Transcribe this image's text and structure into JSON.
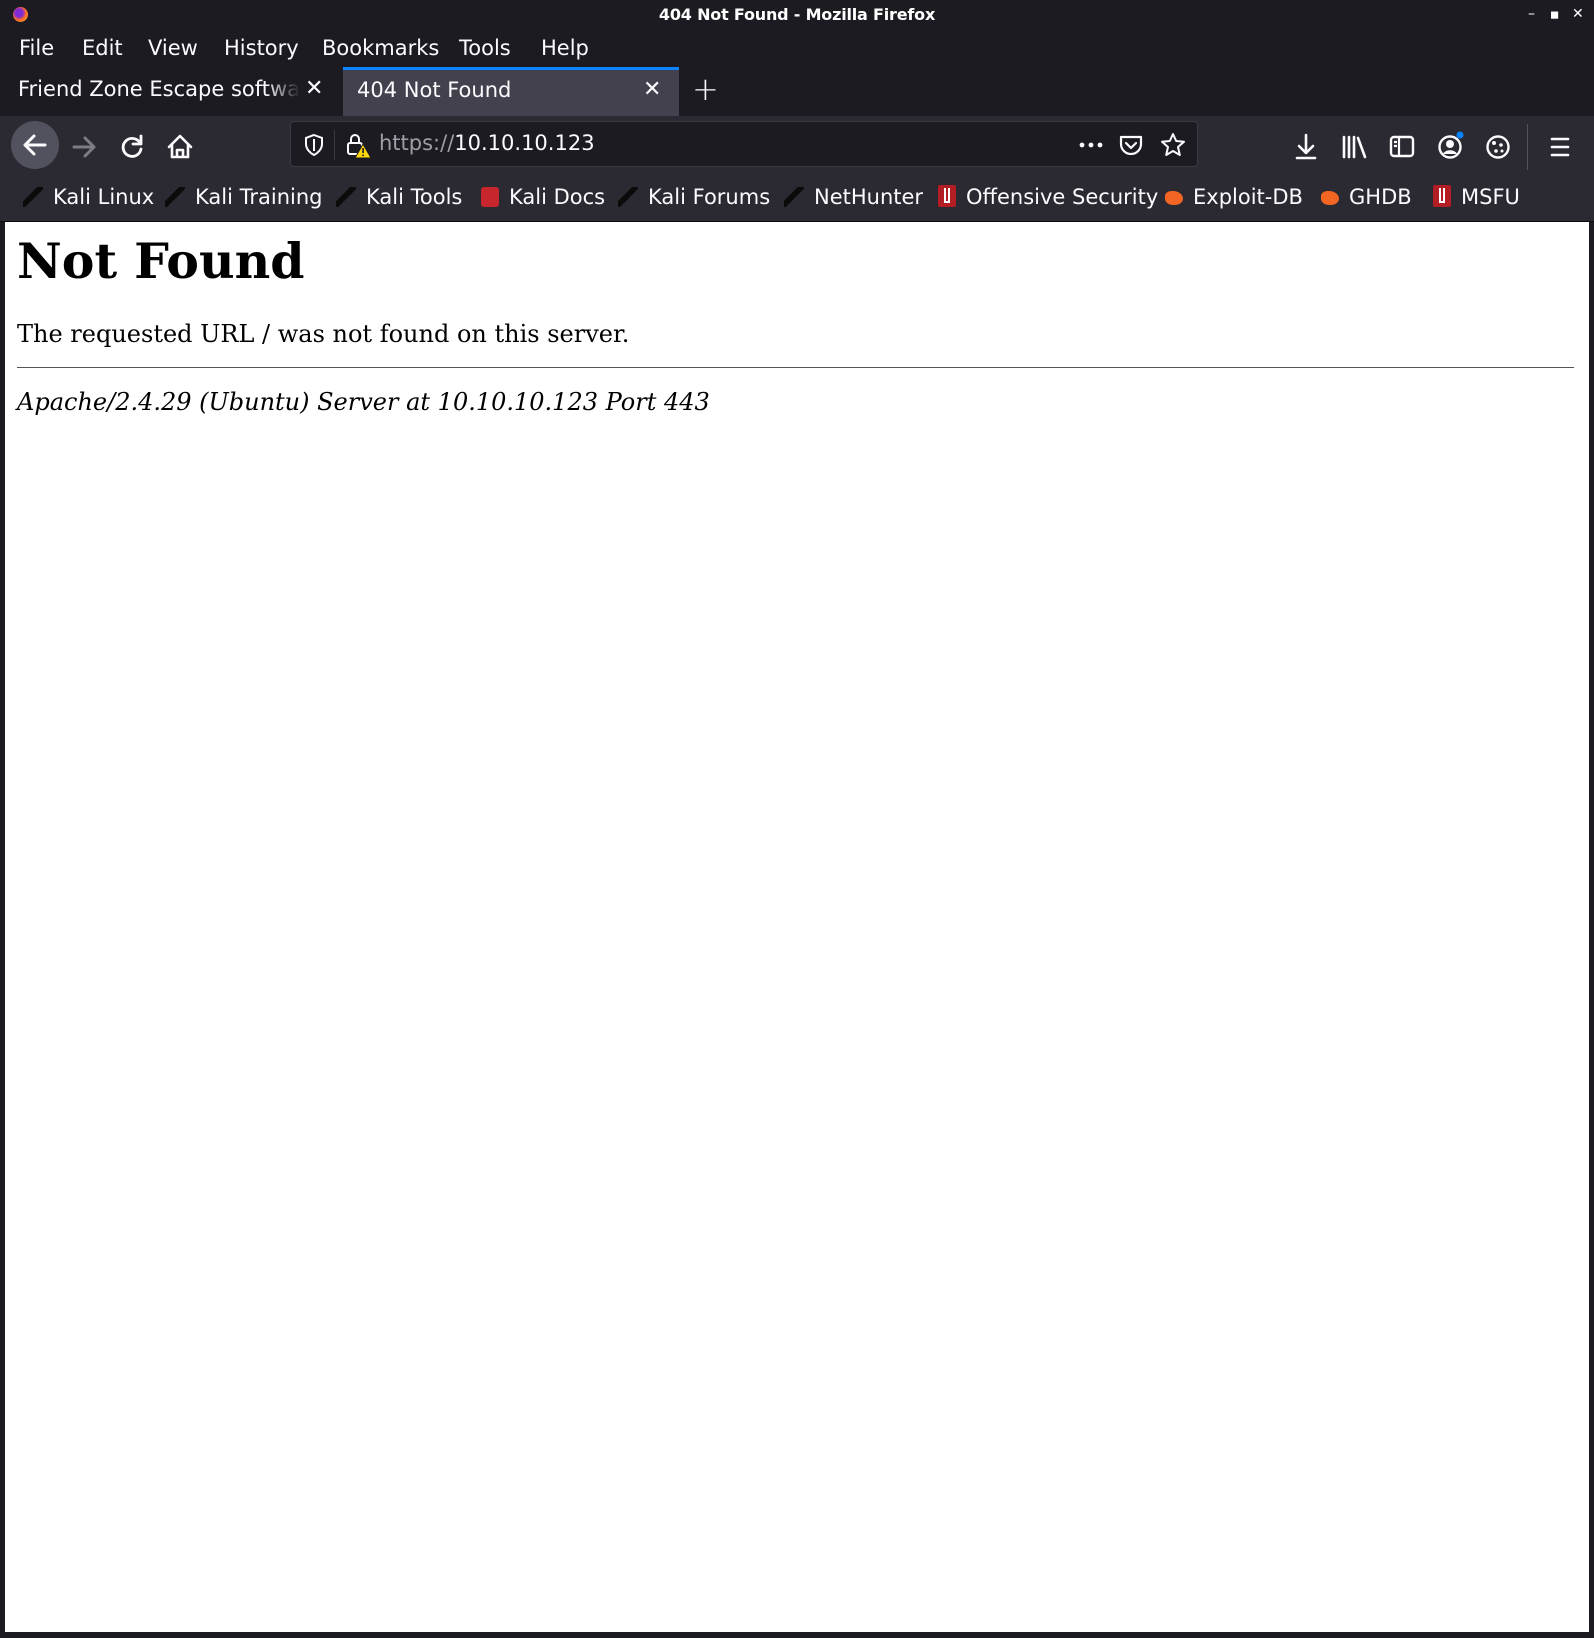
{
  "window": {
    "title": "404 Not Found - Mozilla Firefox"
  },
  "menubar": {
    "items": [
      "File",
      "Edit",
      "View",
      "History",
      "Bookmarks",
      "Tools",
      "Help"
    ]
  },
  "tabs": [
    {
      "label": "Friend Zone Escape software",
      "active": false
    },
    {
      "label": "404 Not Found",
      "active": true
    }
  ],
  "urlbar": {
    "protocol": "https://",
    "host": "10.10.10.123"
  },
  "bookmarks": [
    {
      "label": "Kali Linux",
      "icon": "kali-dragon-icon"
    },
    {
      "label": "Kali Training",
      "icon": "kali-dragon-icon"
    },
    {
      "label": "Kali Tools",
      "icon": "kali-dragon-icon"
    },
    {
      "label": "Kali Docs",
      "icon": "kali-docs-icon"
    },
    {
      "label": "Kali Forums",
      "icon": "kali-dragon-icon"
    },
    {
      "label": "NetHunter",
      "icon": "kali-dragon-icon"
    },
    {
      "label": "Offensive Security",
      "icon": "offsec-icon"
    },
    {
      "label": "Exploit-DB",
      "icon": "exploit-db-icon"
    },
    {
      "label": "GHDB",
      "icon": "exploit-db-icon"
    },
    {
      "label": "MSFU",
      "icon": "offsec-icon"
    }
  ],
  "page": {
    "heading": "Not Found",
    "message": "The requested URL / was not found on this server.",
    "signature": "Apache/2.4.29 (Ubuntu) Server at 10.10.10.123 Port 443"
  },
  "colors": {
    "chrome_dark": "#1c1b22",
    "toolbar": "#2b2a33",
    "active_tab": "#42414d",
    "accent": "#0a84ff"
  }
}
